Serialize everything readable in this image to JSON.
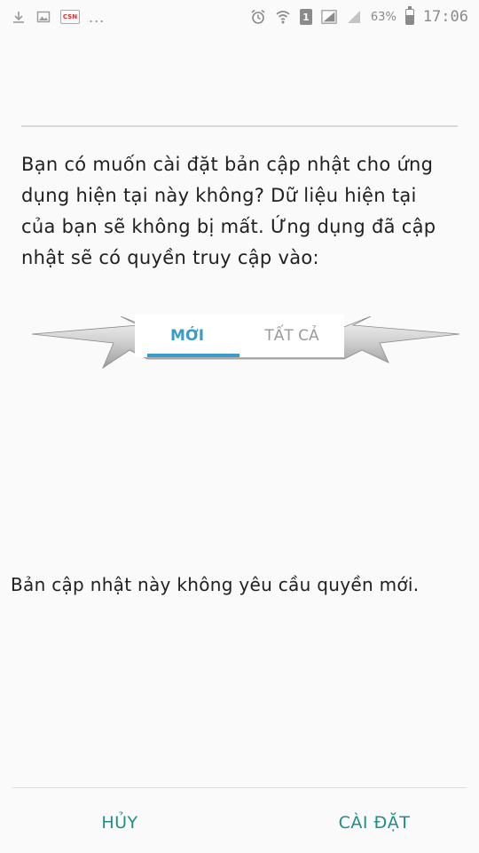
{
  "status_bar": {
    "left_icons": [
      "download-icon",
      "image-icon",
      "csn-app-icon"
    ],
    "csn_label": "CSN",
    "more_indicator": "...",
    "right_icons": [
      "alarm-icon",
      "wifi-icon",
      "sim-icon",
      "signal-icon",
      "signal-2-icon",
      "battery-icon"
    ],
    "sim_number": "1",
    "battery_percent": "63%",
    "battery_level": 0.63,
    "time": "17:06"
  },
  "dialog": {
    "description": "Bạn có muốn cài đặt bản cập nhật cho ứng dụng hiện tại này không? Dữ liệu hiện tại của bạn sẽ không bị mất. Ứng dụng đã cập nhật sẽ có quyền truy cập vào:",
    "tabs": [
      {
        "label": "MỚI",
        "active": true
      },
      {
        "label": "TẤT CẢ",
        "active": false
      }
    ],
    "empty_message": "Bản cập nhật này không yêu cầu quyền mới.",
    "cancel_label": "HỦY",
    "install_label": "CÀI ĐẶT"
  },
  "colors": {
    "accent_tab": "#3b9bc9",
    "action_text": "#1d8f86",
    "background": "#fafafa"
  }
}
